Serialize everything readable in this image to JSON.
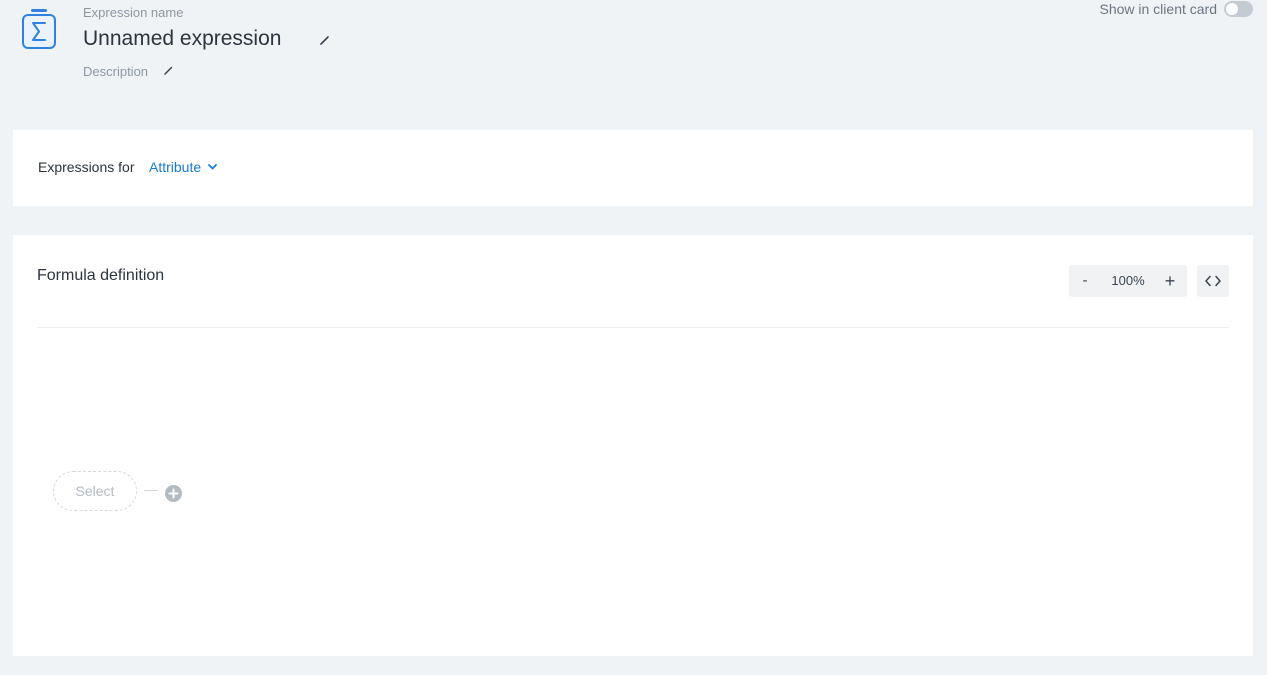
{
  "header": {
    "name_label": "Expression name",
    "name_value": "Unnamed expression",
    "description_label": "Description",
    "show_in_client_card_label": "Show in client card",
    "show_in_client_card_enabled": false
  },
  "expressions": {
    "label": "Expressions for",
    "selected": "Attribute"
  },
  "formula": {
    "title": "Formula definition",
    "zoom_minus": "-",
    "zoom_level": "100%",
    "zoom_plus": "+",
    "node_placeholder": "Select"
  },
  "colors": {
    "accent": "#1a7ad9",
    "icon": "#2f82e0",
    "background": "#f0f3f5",
    "toggle_off": "#c4cbd3"
  },
  "icons": {
    "expression": "sigma-icon",
    "edit": "pencil-icon",
    "dropdown": "chevron-down-icon",
    "code": "code-brackets-icon",
    "add": "plus-circle-icon"
  }
}
